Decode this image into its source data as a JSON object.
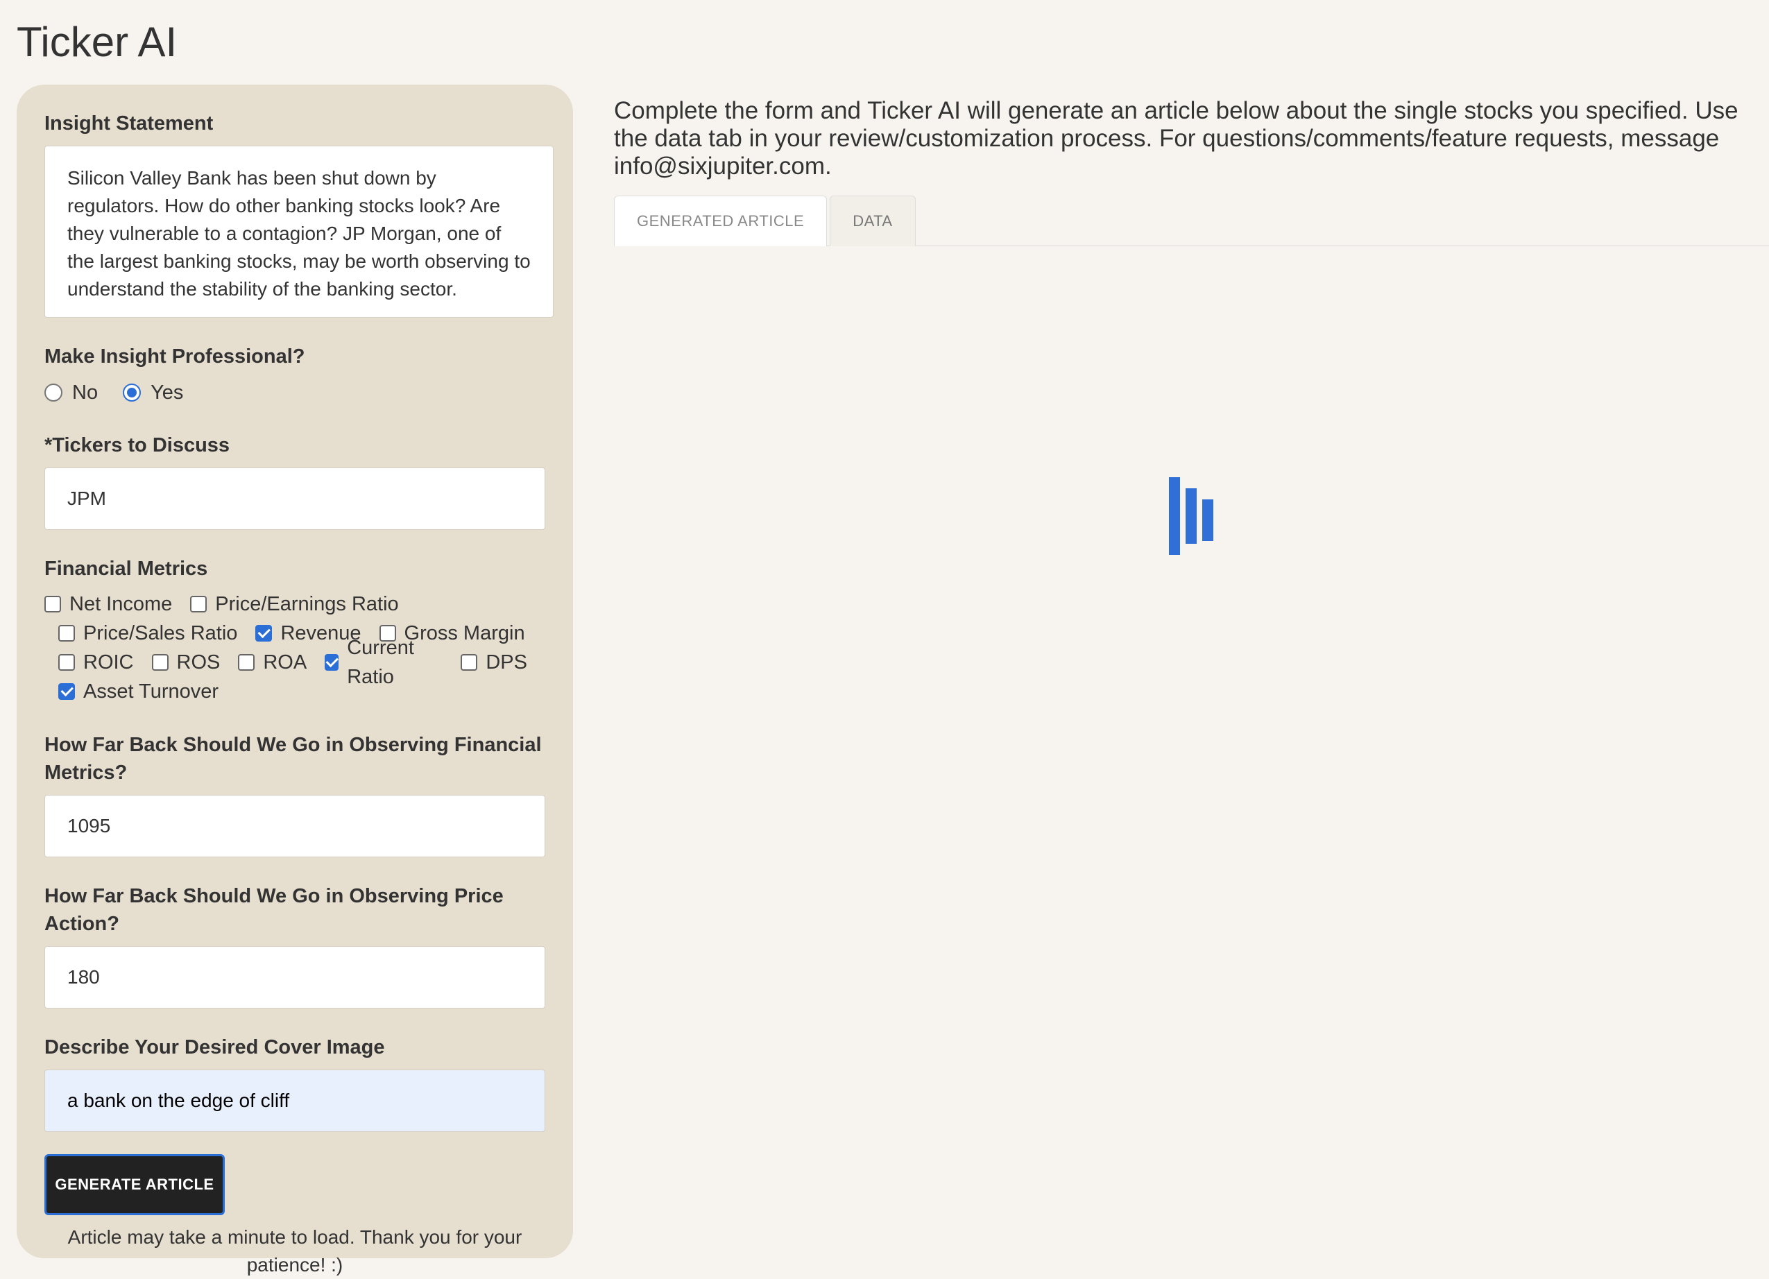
{
  "app": {
    "title": "Ticker AI"
  },
  "form": {
    "insight_label": "Insight Statement",
    "insight_value": "Silicon Valley Bank has been shut down by regulators. How do other banking stocks look? Are they vulnerable to a contagion? JP Morgan, one of the largest banking stocks, may be worth observing to understand the stability of the banking sector.",
    "professional_label": "Make Insight Professional?",
    "professional_options": [
      {
        "label": "No",
        "selected": false
      },
      {
        "label": "Yes",
        "selected": true
      }
    ],
    "tickers_label": "*Tickers to Discuss",
    "tickers_value": "JPM",
    "metrics_label": "Financial Metrics",
    "metrics": [
      {
        "label": "Net Income",
        "checked": false
      },
      {
        "label": "Price/Earnings Ratio",
        "checked": false
      },
      {
        "label": "Price/Sales Ratio",
        "checked": false
      },
      {
        "label": "Revenue",
        "checked": true
      },
      {
        "label": "Gross Margin",
        "checked": false
      },
      {
        "label": "ROIC",
        "checked": false
      },
      {
        "label": "ROS",
        "checked": false
      },
      {
        "label": "ROA",
        "checked": false
      },
      {
        "label": "Current Ratio",
        "checked": true
      },
      {
        "label": "DPS",
        "checked": false
      },
      {
        "label": "Asset Turnover",
        "checked": true
      }
    ],
    "metrics_back_label": "How Far Back Should We Go in Observing Financial Metrics?",
    "metrics_back_value": "1095",
    "price_back_label": "How Far Back Should We Go in Observing Price Action?",
    "price_back_value": "180",
    "cover_label": "Describe Your Desired Cover Image",
    "cover_value": "a bank on the edge of cliff",
    "generate_label": "GENERATE ARTICLE",
    "note": "Article may take a minute to load. Thank you for your patience! :)"
  },
  "main": {
    "intro": "Complete the form and Ticker AI will generate an article below about the single stocks you specified. Use the data tab in your review/customization process. For questions/comments/feature requests, message info@sixjupiter.com.",
    "tabs": [
      {
        "label": "GENERATED ARTICLE",
        "active": true
      },
      {
        "label": "DATA",
        "active": false
      }
    ]
  },
  "colors": {
    "accent": "#2b6fd6",
    "panel": "#e6dece",
    "background": "#f7f4ef",
    "button": "#222222"
  },
  "icons": {
    "loader": "loading-bars-icon"
  }
}
